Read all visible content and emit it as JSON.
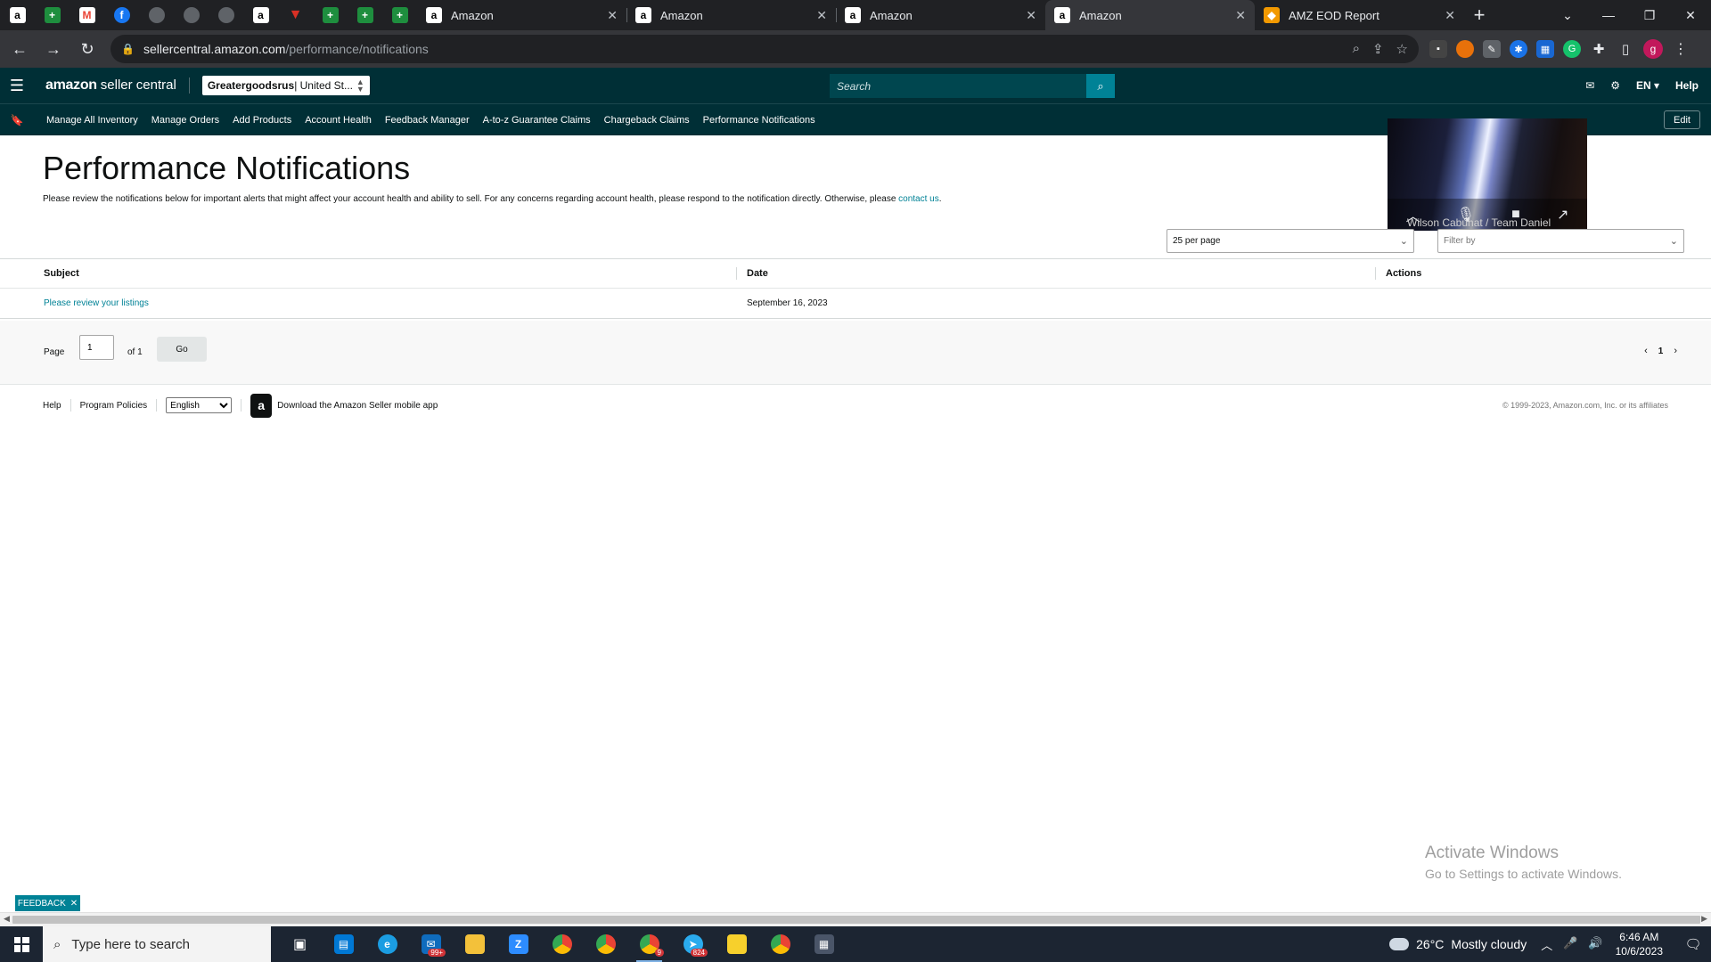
{
  "browser": {
    "tabs": [
      {
        "label": "Amazon",
        "active": false
      },
      {
        "label": "Amazon",
        "active": false
      },
      {
        "label": "Amazon",
        "active": false
      },
      {
        "label": "Amazon",
        "active": true
      },
      {
        "label": "AMZ EOD Report",
        "active": false
      }
    ],
    "url_host": "sellercentral.amazon.com",
    "url_path": "/performance/notifications",
    "profile_initial": "g"
  },
  "header": {
    "logo_bold": "amazon",
    "logo_rest": "seller central",
    "account_name": "Greatergoodsrus",
    "account_region": " | United St...",
    "search_placeholder": "Search",
    "language": "EN",
    "help": "Help"
  },
  "nav": {
    "links": [
      "Manage All Inventory",
      "Manage Orders",
      "Add Products",
      "Account Health",
      "Feedback Manager",
      "A-to-z Guarantee Claims",
      "Chargeback Claims",
      "Performance Notifications"
    ],
    "edit": "Edit"
  },
  "video_call": {
    "participant": "Wilson Cabuhat / Team Daniel"
  },
  "page": {
    "title": "Performance Notifications",
    "intro": "Please review the notifications below for important alerts that might affect your account health and ability to sell. For any concerns regarding account health, please respond to the notification directly. Otherwise, please ",
    "contact_link": "contact us",
    "intro_end": ".",
    "per_page": "25 per page",
    "filter_placeholder": "Filter by"
  },
  "table": {
    "headers": [
      "Subject",
      "Date",
      "Actions"
    ],
    "rows": [
      {
        "subject": "Please review your listings",
        "date": "September 16, 2023",
        "actions": ""
      }
    ]
  },
  "pager": {
    "page_label": "Page",
    "page_value": "1",
    "of_label": "of 1",
    "go": "Go",
    "current": "1"
  },
  "footer": {
    "help": "Help",
    "program_policies": "Program Policies",
    "language": "English",
    "app_link": "Download the Amazon Seller mobile app",
    "copyright": "© 1999-2023, Amazon.com, Inc. or its affiliates"
  },
  "feedback": "FEEDBACK",
  "windows": {
    "activate_title": "Activate Windows",
    "activate_sub": "Go to Settings to activate Windows.",
    "search_placeholder": "Type here to search",
    "mail_badge": "99+",
    "telegram_badge": "824",
    "chrome_badge": "9",
    "temperature": "26°C",
    "weather": "Mostly cloudy",
    "time": "6:46 AM",
    "date": "10/6/2023"
  }
}
